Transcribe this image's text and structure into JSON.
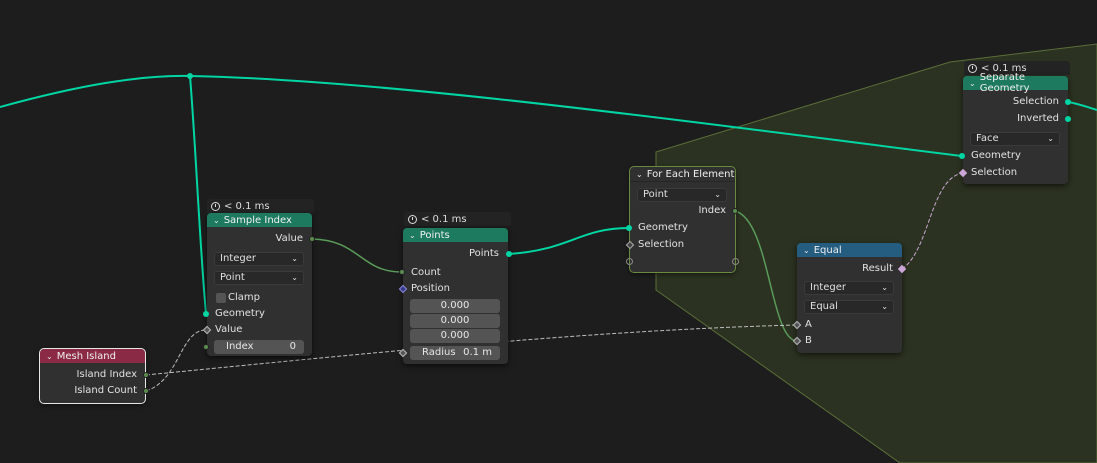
{
  "timings": {
    "sample_index": "< 0.1 ms",
    "points": "< 0.1 ms",
    "separate_geometry": "< 0.1 ms"
  },
  "mesh_island": {
    "title": "Mesh Island",
    "out_island_index": "Island Index",
    "out_island_count": "Island Count"
  },
  "sample_index": {
    "title": "Sample Index",
    "out_value": "Value",
    "type_dropdown": "Integer",
    "domain_dropdown": "Point",
    "clamp_label": "Clamp",
    "in_geometry": "Geometry",
    "in_value": "Value",
    "index_label": "Index",
    "index_value": "0"
  },
  "points": {
    "title": "Points",
    "out_points": "Points",
    "in_count": "Count",
    "in_position": "Position",
    "pos_x": "0.000",
    "pos_y": "0.000",
    "pos_z": "0.000",
    "radius_label": "Radius",
    "radius_value": "0.1 m"
  },
  "for_each": {
    "title": "For Each Element",
    "domain_dropdown": "Point",
    "out_index": "Index",
    "in_geometry": "Geometry",
    "in_selection": "Selection"
  },
  "equal": {
    "title": "Equal",
    "out_result": "Result",
    "type_dropdown": "Integer",
    "mode_dropdown": "Equal",
    "in_a": "A",
    "in_b": "B"
  },
  "separate_geometry": {
    "title": "Separate Geometry",
    "out_selection": "Selection",
    "out_inverted": "Inverted",
    "domain_dropdown": "Face",
    "in_geometry": "Geometry",
    "in_selection": "Selection"
  },
  "colors": {
    "background": "#1d1d1d",
    "geometry_link": "#00d6a3",
    "int_link": "#5a9c5a",
    "bool_link": "#c8a8d0",
    "zone_fill": "#2b3221",
    "zone_border": "#5a6e38",
    "header_geometry": "#1e7a5e",
    "header_input": "#8a2a45",
    "header_utility": "#245d80"
  }
}
